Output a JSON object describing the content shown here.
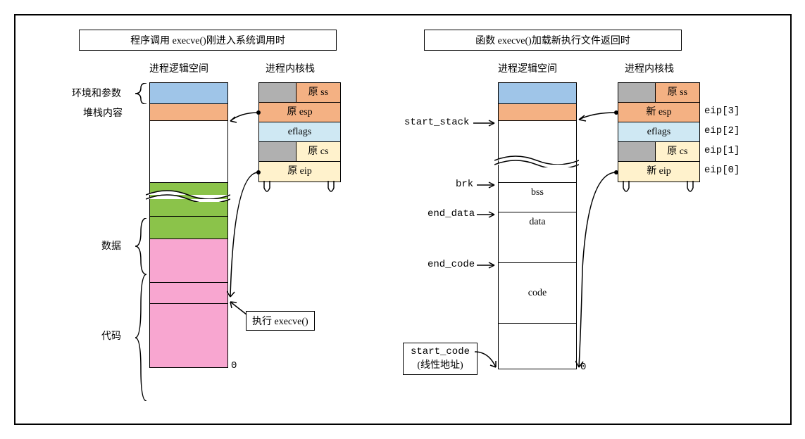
{
  "left": {
    "title": "程序调用 execve()刚进入系统调用时",
    "proc_header": "进程逻辑空间",
    "kernel_header": "进程内核栈",
    "env_args": "环境和参数",
    "stack_content": "堆栈内容",
    "data": "数据",
    "code": "代码",
    "zero": "0",
    "exec_call": "执行 execve()",
    "k": {
      "ss": "原 ss",
      "esp": "原 esp",
      "eflags": "eflags",
      "cs": "原 cs",
      "eip": "原 eip"
    }
  },
  "right": {
    "title": "函数 execve()加载新执行文件返回时",
    "proc_header": "进程逻辑空间",
    "kernel_header": "进程内核栈",
    "start_stack": "start_stack",
    "brk": "brk",
    "bss": "bss",
    "end_data": "end_data",
    "data_seg": "data",
    "end_code": "end_code",
    "code_seg": "code",
    "start_code": "start_code",
    "linaddr": "(线性地址)",
    "zero": "0",
    "k": {
      "ss": "原 ss",
      "esp": "新 esp",
      "eflags": "eflags",
      "cs": "原 cs",
      "eip": "新 eip"
    },
    "eip3": "eip[3]",
    "eip2": "eip[2]",
    "eip1": "eip[1]",
    "eip0": "eip[0]"
  },
  "colors": {
    "blue": "#9fc5e8",
    "orange": "#f4b183",
    "green": "#8bc34a",
    "pink": "#f8a6d0",
    "cyan": "#cfe8f3",
    "yellow": "#fff2cc",
    "gray": "#b0b0b0"
  }
}
